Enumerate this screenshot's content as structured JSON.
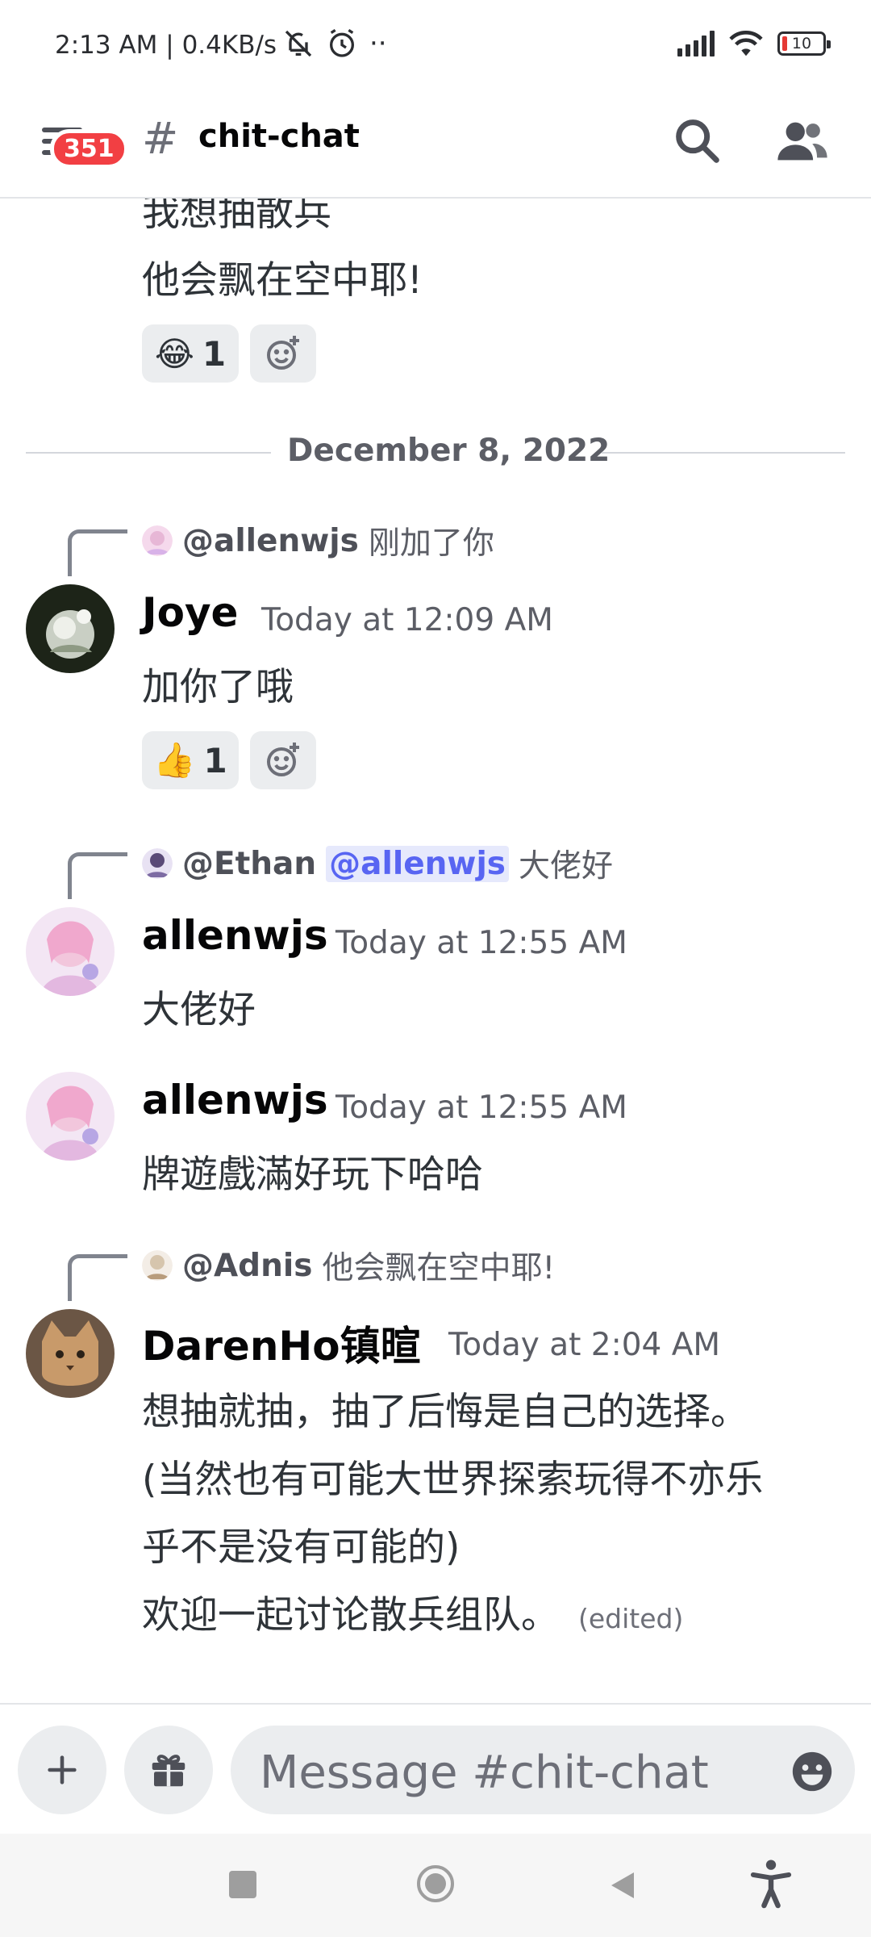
{
  "status_bar": {
    "time": "2:13 AM | 0.4KB/s",
    "extra_icons": "··",
    "battery_level": "10"
  },
  "header": {
    "badge_count": "351",
    "hash": "#",
    "channel": "chit-chat"
  },
  "messages": {
    "partial_line1": "我想抽散兵",
    "partial_line2": "他会飘在空中耶!",
    "partial_reaction": {
      "emoji": "😂",
      "count": "1"
    },
    "date_divider": "December 8, 2022",
    "joye": {
      "reply_to": "@allenwjs",
      "reply_text": "刚加了你",
      "author": "Joye",
      "time": "Today at 12:09 AM",
      "text": "加你了哦",
      "reaction": {
        "emoji": "👍",
        "count": "1"
      }
    },
    "allen1": {
      "reply_to": "@Ethan",
      "reply_mention": "@allenwjs",
      "reply_text": "大佬好",
      "author": "allenwjs",
      "time": "Today at 12:55 AM",
      "text": "大佬好"
    },
    "allen2": {
      "author": "allenwjs",
      "time": "Today at 12:55 AM",
      "text": "牌遊戲滿好玩下哈哈"
    },
    "daren": {
      "reply_to": "@Adnis",
      "reply_text": "他会飘在空中耶!",
      "author": "DarenHo镇暄",
      "time": "Today at 2:04 AM",
      "line1": "想抽就抽，抽了后悔是自己的选择。",
      "line2": "(当然也有可能大世界探索玩得不亦乐",
      "line3": "乎不是没有可能的)",
      "line4": "欢迎一起讨论散兵组队。",
      "edited": "(edited)"
    }
  },
  "composer": {
    "placeholder": "Message #chit-chat"
  }
}
